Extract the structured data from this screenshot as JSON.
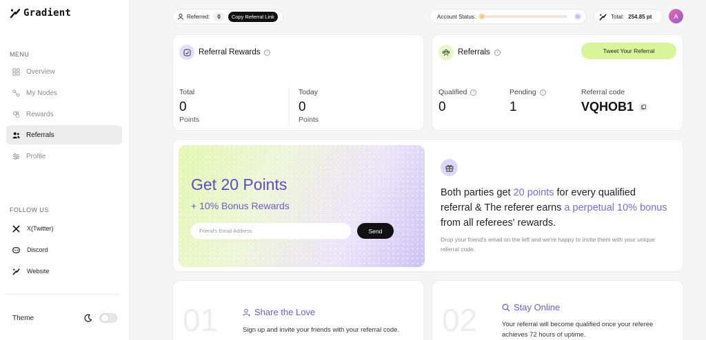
{
  "app": {
    "logo_text": "Gradient"
  },
  "sidebar": {
    "menu_label": "MENU",
    "items": [
      {
        "label": "Overview"
      },
      {
        "label": "My Nodes"
      },
      {
        "label": "Rewards"
      },
      {
        "label": "Referrals"
      },
      {
        "label": "Profile"
      }
    ],
    "active_item": "Referrals",
    "follow_label": "FOLLOW US",
    "follow": [
      {
        "label": "X(Twitter)"
      },
      {
        "label": "Discord"
      },
      {
        "label": "Website"
      }
    ],
    "theme_label": "Theme"
  },
  "topbar": {
    "referred_label": "Referred:",
    "referred_count": "0",
    "copy_link_label": "Copy Referral Link",
    "account_status_label": "Account Status:",
    "account_status_level": 0,
    "total_label": "Total:",
    "total_value": "254.85 pt",
    "avatar_initial": "A"
  },
  "referral_rewards": {
    "title": "Referral Rewards",
    "total_label": "Total",
    "total_value": "0",
    "total_unit": "Points",
    "today_label": "Today",
    "today_value": "0",
    "today_unit": "Points"
  },
  "referrals": {
    "title": "Referrals",
    "tweet_label": "Tweet Your Referral",
    "qualified_label": "Qualified",
    "qualified_value": "0",
    "pending_label": "Pending",
    "pending_value": "1",
    "code_label": "Referral code",
    "code_value": "VQHOB1"
  },
  "promo": {
    "title": "Get 20 Points",
    "subtitle": "+ 10% Bonus Rewards",
    "email_placeholder": "Friend's Email Address",
    "send_label": "Send",
    "text_part1": "Both parties get ",
    "text_hl1": "20 points",
    "text_part2": " for every qualified referral & The referer earns ",
    "text_hl2": "a perpetual 10% bonus",
    "text_part3": " from all referees' rewards.",
    "note": "Drop your friend's email on the left and we're happy to invite them with your unique referral code."
  },
  "steps": [
    {
      "number": "01",
      "title": "Share the Love",
      "desc": "Sign up and invite your friends with your referral code."
    },
    {
      "number": "02",
      "title": "Stay Online",
      "desc": "Your referral will become qualified once your referee achieves 72 hours of uptime."
    }
  ],
  "colors": {
    "accent": "#6a5ccf",
    "lime": "#d9f59a",
    "active_bg": "#ececec"
  }
}
